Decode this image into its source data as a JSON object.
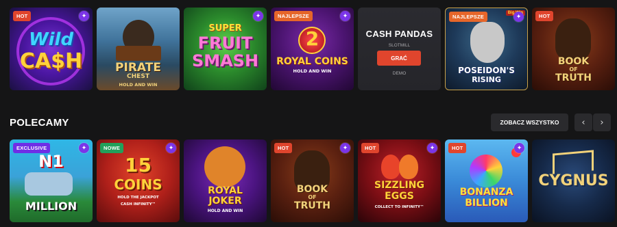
{
  "top_row": [
    {
      "badge": "HOT",
      "badge_type": "hot",
      "spark": true,
      "title_line1": "Wild",
      "title_line2": "CA$H",
      "colors": {
        "line1": "#3fd6ff",
        "line2": "#ffd23a"
      }
    },
    {
      "badge": "",
      "badge_type": "",
      "spark": false,
      "title_line1": "PIRATE",
      "title_line2": "CHEST",
      "sub": "HOLD AND WIN",
      "colors": {
        "line1": "#f2d27a",
        "line2": "#f2d27a"
      }
    },
    {
      "badge": "",
      "badge_type": "",
      "spark": true,
      "title_line1": "SUPER",
      "title_line2": "FRUIT",
      "title_line3": "SMASH",
      "colors": {
        "line1": "#ffe23a",
        "line2": "#ff7ad6",
        "line3": "#ff7ad6"
      }
    },
    {
      "badge": "NAJLEPSZE",
      "badge_type": "naj",
      "spark": true,
      "number": "2",
      "title_line1": "ROYAL COINS",
      "sub": "HOLD AND WIN",
      "colors": {
        "line1": "#ffd23a"
      }
    },
    {
      "badge": "",
      "badge_type": "",
      "spark": false,
      "hover": true,
      "title": "CASH PANDAS",
      "provider": "SLOTMILL",
      "play_label": "GRAĆ",
      "demo_label": "DEMO"
    },
    {
      "badge": "NAJLEPSZE",
      "badge_type": "naj",
      "spark": true,
      "title_line1": "POSEIDON'S",
      "title_line2": "RISING",
      "ribbon": "Big Win",
      "colors": {
        "line1": "#ffffff"
      }
    },
    {
      "badge": "HOT",
      "badge_type": "hot",
      "spark": false,
      "title_line1": "BOOK",
      "title_line2": "OF",
      "title_line3": "TRUTH",
      "colors": {
        "line1": "#f2d27a"
      }
    }
  ],
  "section": {
    "title": "POLECAMY",
    "see_all_label": "ZOBACZ WSZYSTKO",
    "prev_icon": "‹",
    "next_icon": "›"
  },
  "bottom_row": [
    {
      "badge": "EXCLUSIVE",
      "badge_type": "exc",
      "spark": true,
      "number": "N1",
      "title_line1": "MILLION",
      "colors": {
        "line1": "#ffffff"
      }
    },
    {
      "badge": "NOWE",
      "badge_type": "nowe",
      "spark": true,
      "number": "15",
      "title_line1": "COINS",
      "sub": "HOLD THE JACKPOT",
      "sub2": "CASH INFINITY™",
      "colors": {
        "line1": "#ffd23a"
      }
    },
    {
      "badge": "",
      "badge_type": "",
      "spark": false,
      "title_line1": "ROYAL",
      "title_line2": "JOKER",
      "sub": "HOLD AND WIN",
      "colors": {
        "line1": "#ffd23a"
      }
    },
    {
      "badge": "HOT",
      "badge_type": "hot",
      "spark": true,
      "title_line1": "BOOK",
      "title_line2": "OF",
      "title_line3": "TRUTH",
      "colors": {
        "line1": "#f2d27a"
      }
    },
    {
      "badge": "HOT",
      "badge_type": "hot",
      "spark": true,
      "title_line1": "SIZZLING",
      "title_line2": "EGGS",
      "sub": "COLLECT TO INFINITY™",
      "colors": {
        "line1": "#ffd23a"
      }
    },
    {
      "badge": "HOT",
      "badge_type": "hot",
      "spark": true,
      "title_line1": "BONANZA",
      "title_line2": "BILLION",
      "colors": {
        "line1": "#ffe23a"
      }
    },
    {
      "badge": "",
      "badge_type": "",
      "spark": false,
      "title_line1": "CYGNUS",
      "colors": {
        "line1": "#f2d27a"
      }
    }
  ],
  "icons": {
    "spark": "sparkle-icon"
  }
}
